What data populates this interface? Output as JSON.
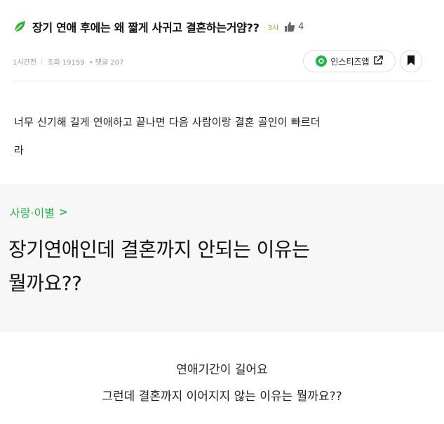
{
  "post": {
    "title": "장기 연애 후에는 왜 짧게 사귀고 결혼하는거얌??",
    "rank": "3시",
    "likes": "4",
    "time": "1시간전",
    "separator": "|",
    "views": "조회 19159",
    "comments": "• 댓글 207",
    "instagram_label": "인스티즈앱",
    "body_line1": "너무 신기해 길게 연애하고 끝나면 다음 사람이랑 결혼 골인이 빠르더",
    "body_line2": "라"
  },
  "qa": {
    "category": "사랑·이별",
    "chevron": ">",
    "title_line1": "장기연애인데 결혼까지 안되는 이유는",
    "title_line2": "뭘까요??"
  },
  "answer": {
    "line1": "연애기간이 길어요",
    "line2": "그런데 결혼까지 이어지지 않는 이유는 뭘까요??"
  },
  "icons": {
    "leaf": "leaf-icon",
    "thumb": "thumbs-up-icon",
    "external": "external-link-icon",
    "bookmark": "bookmark-icon"
  },
  "colors": {
    "accent_green": "#2ab34b",
    "qa_background": "#f6f7f6"
  }
}
